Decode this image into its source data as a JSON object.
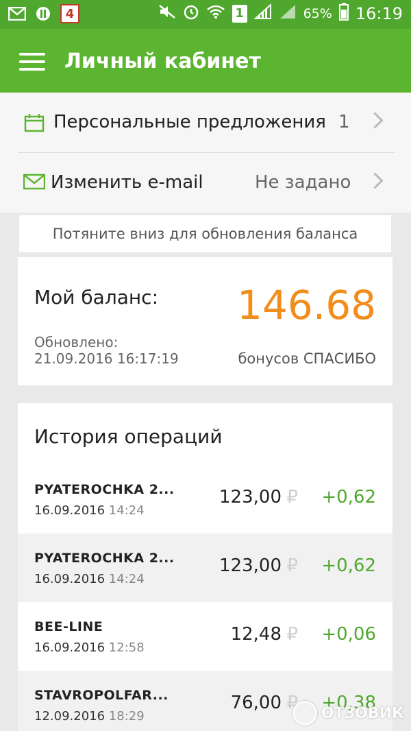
{
  "status_bar": {
    "battery": "65%",
    "time": "16:19",
    "sim": "1",
    "left_badge": "4",
    "icons": [
      "mail-icon",
      "app-icon",
      "badge-icon",
      "mute-icon",
      "alarm-icon",
      "wifi-icon",
      "sim-icon",
      "signal-icon",
      "signal2-icon",
      "battery-icon"
    ]
  },
  "appbar": {
    "title": "Личный кабинет",
    "menu_icon": "hamburger-menu-icon"
  },
  "menu": {
    "offers": {
      "label": "Персональные предложения",
      "value": "1",
      "icon": "calendar-icon"
    },
    "email": {
      "label": "Изменить e-mail",
      "value": "Не задано",
      "icon": "envelope-icon"
    }
  },
  "pull_hint": "Потяните вниз для обновления баланса",
  "balance": {
    "label": "Мой баланс:",
    "value": "146.68",
    "updated_label": "Обновлено:",
    "updated_at": "21.09.2016 16:17:19",
    "unit": "бонусов СПАСИБО"
  },
  "history": {
    "title": "История операций",
    "currency_symbol": "₽",
    "items": [
      {
        "name": "PYATEROCHKA 2...",
        "date": "16.09.2016",
        "time": "14:24",
        "amount": "123,00",
        "bonus": "+0,62"
      },
      {
        "name": "PYATEROCHKA 2...",
        "date": "16.09.2016",
        "time": "14:24",
        "amount": "123,00",
        "bonus": "+0,62"
      },
      {
        "name": "BEE-LINE",
        "date": "16.09.2016",
        "time": "12:58",
        "amount": "12,48",
        "bonus": "+0,06"
      },
      {
        "name": "STAVROPOLFAR...",
        "date": "12.09.2016",
        "time": "18:29",
        "amount": "76,00",
        "bonus": "+0,38"
      }
    ]
  },
  "watermark": "ОТЗОВИК",
  "colors": {
    "appbar": "#5cb531",
    "accent_orange": "#f28c1a",
    "bonus_green": "#4fa72e"
  }
}
